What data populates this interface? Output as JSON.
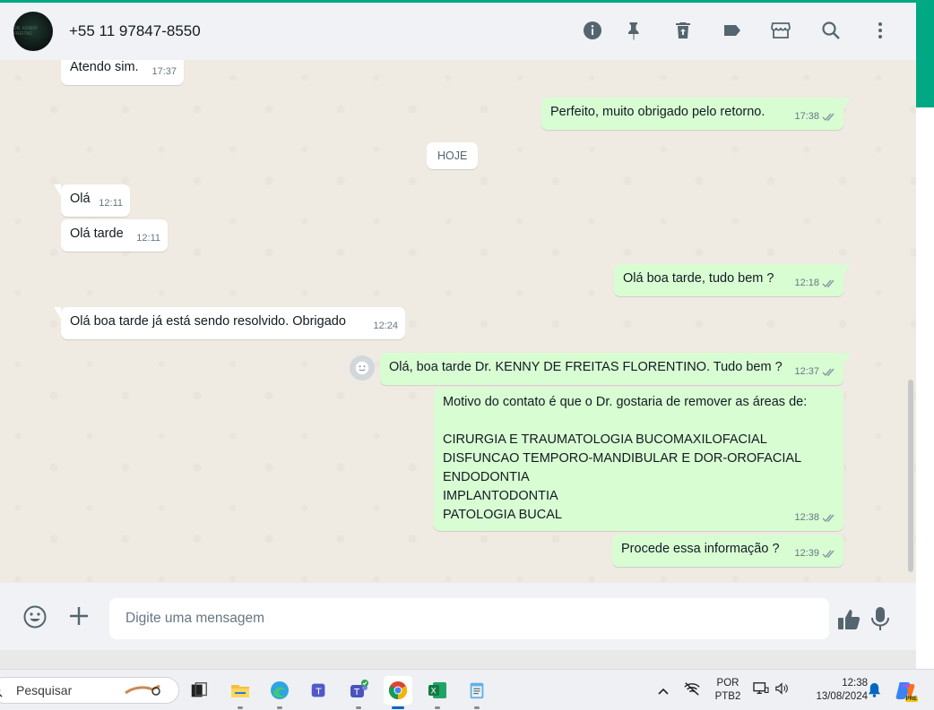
{
  "header": {
    "contact_name": "+55 11 97847-8550",
    "avatar_text": "DR. KENNY FREITAS",
    "icons": [
      "info-icon",
      "pin-icon",
      "delete-icon",
      "label-icon",
      "catalog-icon",
      "search-icon",
      "menu-icon"
    ]
  },
  "chat": {
    "date_chip": "HOJE",
    "messages": [
      {
        "dir": "in",
        "text": "Atendo sim.",
        "time": "17:37"
      },
      {
        "dir": "out",
        "text": "Perfeito, muito obrigado pelo retorno.",
        "time": "17:38",
        "read": true
      },
      {
        "dir": "in",
        "text": "Olá",
        "time": "12:11"
      },
      {
        "dir": "in",
        "text": "Olá tarde",
        "time": "12:11"
      },
      {
        "dir": "out",
        "text": "Olá boa tarde, tudo bem ?",
        "time": "12:18",
        "read": true
      },
      {
        "dir": "in",
        "text": "Olá boa tarde já está sendo resolvido. Obrigado",
        "time": "12:24"
      },
      {
        "dir": "out",
        "text": "Olá, boa tarde Dr. KENNY DE FREITAS FLORENTINO. Tudo bem ?",
        "time": "12:37",
        "read": true
      },
      {
        "dir": "out",
        "lines": [
          "Motivo do contato é que o Dr. gostaria de remover as áreas de:",
          "",
          "CIRURGIA E TRAUMATOLOGIA BUCOMAXILOFACIAL",
          "DISFUNCAO TEMPORO-MANDIBULAR E DOR-OROFACIAL",
          "ENDODONTIA",
          "IMPLANTODONTIA",
          "PATOLOGIA BUCAL"
        ],
        "time": "12:38",
        "read": true
      },
      {
        "dir": "out",
        "text": "Procede essa informação ?",
        "time": "12:39",
        "read": true
      }
    ]
  },
  "composer": {
    "placeholder": "Digite uma mensagem"
  },
  "taskbar": {
    "search_label": "Pesquisar",
    "language_top": "POR",
    "language_bottom": "PTB2",
    "clock_time": "12:38",
    "clock_date": "13/08/2024",
    "copilot_badge": "PRE"
  },
  "colors": {
    "accent": "#00a884",
    "incoming_bubble": "#ffffff",
    "outgoing_bubble": "#d9fdd3",
    "chat_background": "#efeae2",
    "read_tick": "#53bdeb"
  }
}
